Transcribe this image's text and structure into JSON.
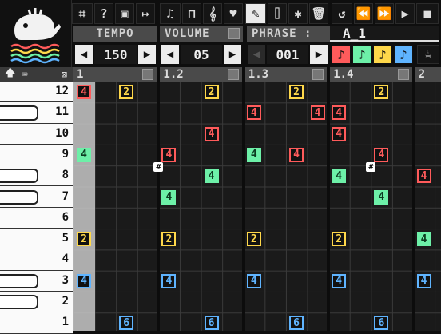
{
  "toolbar": {
    "icons": [
      "menu-grid",
      "help",
      "save",
      "export",
      "keyboard",
      "step",
      "tuning",
      "instrument",
      "pencil",
      "eraser",
      "select",
      "trash",
      "undo",
      "rewind",
      "forward",
      "play",
      "stop"
    ],
    "active_tool": "pencil"
  },
  "controls": {
    "tempo_label": "TEMPO",
    "volume_label": "VOLUME",
    "phrase_label": "PHRASE :",
    "phrase_name": "A_1",
    "tempo_value": "150",
    "volume_value": "05",
    "phrase_value": "001"
  },
  "instruments": [
    {
      "color": "#ff5b5b",
      "symbol": "♪"
    },
    {
      "color": "#6df0a8",
      "symbol": "♪"
    },
    {
      "color": "#ffd84a",
      "symbol": "♪"
    },
    {
      "color": "#5fb4ff",
      "symbol": "♪"
    }
  ],
  "columns": [
    "1",
    "1.2",
    "1.3",
    "1.4",
    "2"
  ],
  "rows": [
    "12",
    "11",
    "10",
    "9",
    "8",
    "7",
    "6",
    "5",
    "4",
    "3",
    "2",
    "1"
  ],
  "notes": [
    {
      "row": 0,
      "col": 0,
      "label": "4",
      "color": "#ff5b5b"
    },
    {
      "row": 0,
      "col": 2,
      "label": "2",
      "color": "#ffd84a"
    },
    {
      "row": 0,
      "col": 6,
      "label": "2",
      "color": "#ffd84a"
    },
    {
      "row": 0,
      "col": 10,
      "label": "2",
      "color": "#ffd84a"
    },
    {
      "row": 0,
      "col": 14,
      "label": "2",
      "color": "#ffd84a"
    },
    {
      "row": 1,
      "col": 8,
      "label": "4",
      "color": "#ff5b5b"
    },
    {
      "row": 1,
      "col": 11,
      "label": "4",
      "color": "#ff5b5b"
    },
    {
      "row": 1,
      "col": 12,
      "label": "4",
      "color": "#ff5b5b"
    },
    {
      "row": 2,
      "col": 6,
      "label": "4",
      "color": "#ff5b5b"
    },
    {
      "row": 2,
      "col": 12,
      "label": "4",
      "color": "#ff5b5b"
    },
    {
      "row": 3,
      "col": 0,
      "label": "4",
      "color": "#6df0a8"
    },
    {
      "row": 3,
      "col": 4,
      "label": "4",
      "color": "#ff5b5b"
    },
    {
      "row": 3,
      "col": 8,
      "label": "4",
      "color": "#6df0a8"
    },
    {
      "row": 3,
      "col": 10,
      "label": "4",
      "color": "#ff5b5b"
    },
    {
      "row": 3,
      "col": 14,
      "label": "4",
      "color": "#ff5b5b"
    },
    {
      "row": 4,
      "col": 6,
      "label": "4",
      "color": "#6df0a8"
    },
    {
      "row": 4,
      "col": 12,
      "label": "4",
      "color": "#6df0a8"
    },
    {
      "row": 4,
      "col": 16,
      "label": "4",
      "color": "#ff5b5b"
    },
    {
      "row": 5,
      "col": 4,
      "label": "4",
      "color": "#6df0a8"
    },
    {
      "row": 5,
      "col": 14,
      "label": "4",
      "color": "#6df0a8"
    },
    {
      "row": 7,
      "col": 0,
      "label": "2",
      "color": "#ffd84a"
    },
    {
      "row": 7,
      "col": 4,
      "label": "2",
      "color": "#ffd84a"
    },
    {
      "row": 7,
      "col": 8,
      "label": "2",
      "color": "#ffd84a"
    },
    {
      "row": 7,
      "col": 12,
      "label": "2",
      "color": "#ffd84a"
    },
    {
      "row": 7,
      "col": 16,
      "label": "4",
      "color": "#6df0a8"
    },
    {
      "row": 9,
      "col": 0,
      "label": "4",
      "color": "#5fb4ff"
    },
    {
      "row": 9,
      "col": 4,
      "label": "4",
      "color": "#5fb4ff"
    },
    {
      "row": 9,
      "col": 8,
      "label": "4",
      "color": "#5fb4ff"
    },
    {
      "row": 9,
      "col": 12,
      "label": "4",
      "color": "#5fb4ff"
    },
    {
      "row": 9,
      "col": 16,
      "label": "4",
      "color": "#5fb4ff"
    },
    {
      "row": 11,
      "col": 2,
      "label": "6",
      "color": "#5fb4ff"
    },
    {
      "row": 11,
      "col": 6,
      "label": "6",
      "color": "#5fb4ff"
    },
    {
      "row": 11,
      "col": 10,
      "label": "6",
      "color": "#5fb4ff"
    },
    {
      "row": 11,
      "col": 14,
      "label": "6",
      "color": "#5fb4ff"
    }
  ],
  "sharps": [
    {
      "row": 4,
      "col": 4,
      "label": "#"
    },
    {
      "row": 4,
      "col": 14,
      "label": "#"
    }
  ]
}
